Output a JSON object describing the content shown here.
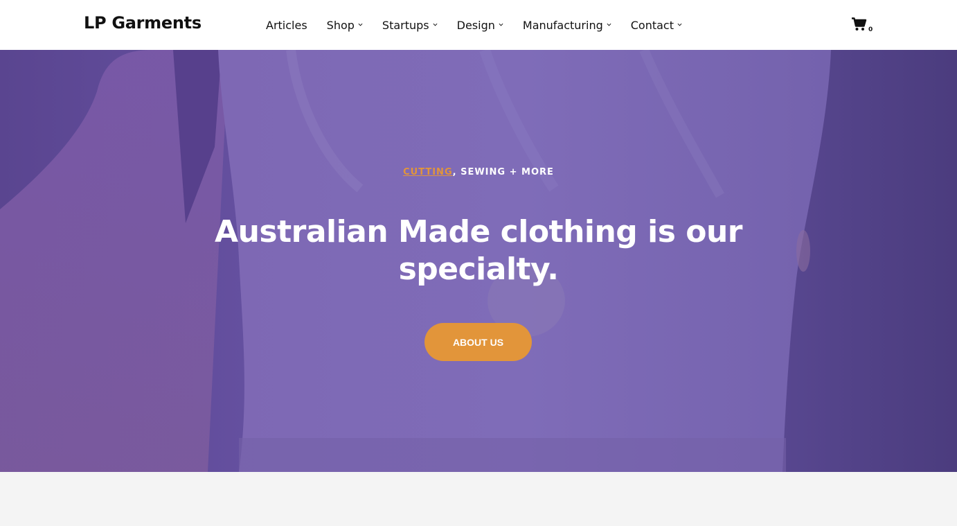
{
  "header": {
    "logo": "LP Garments",
    "nav": [
      {
        "label": "Articles",
        "has_dropdown": false
      },
      {
        "label": "Shop",
        "has_dropdown": true
      },
      {
        "label": "Startups",
        "has_dropdown": true
      },
      {
        "label": "Design",
        "has_dropdown": true
      },
      {
        "label": "Manufacturing",
        "has_dropdown": true
      },
      {
        "label": "Contact",
        "has_dropdown": true
      }
    ],
    "cart_count": "0",
    "cart_icon": "cart-icon"
  },
  "hero": {
    "eyebrow_link": "CUTTING",
    "eyebrow_rest": ", SEWING + MORE",
    "title": "Australian Made clothing is our specialty.",
    "button": "ABOUT US"
  },
  "colors": {
    "accent": "#e2953a",
    "hero_overlay": "#6a55b0",
    "page_background": "#f4f4f4"
  }
}
